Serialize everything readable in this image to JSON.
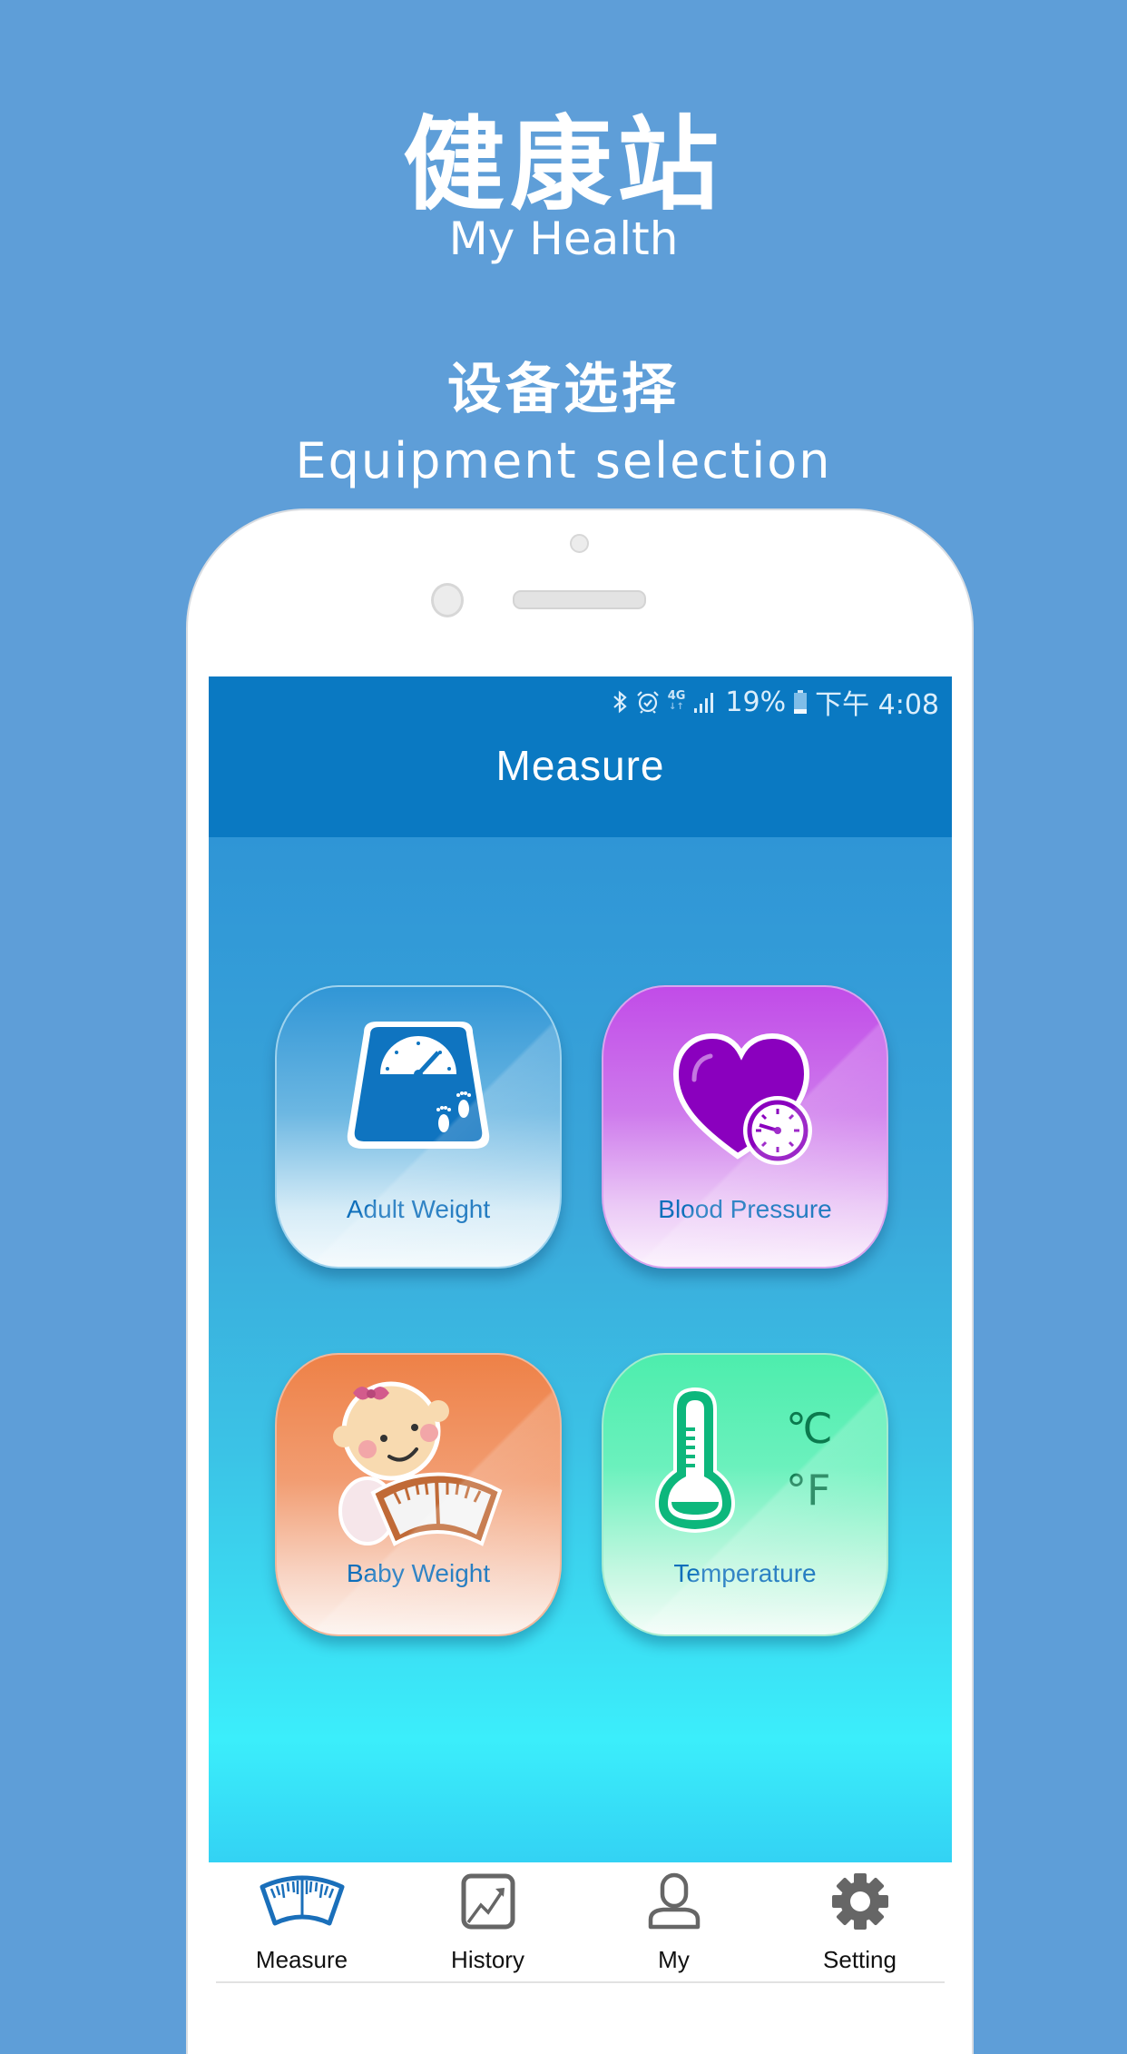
{
  "promo": {
    "title_cn": "健康站",
    "title_en": "My Health",
    "subtitle_cn": "设备选择",
    "subtitle_en": "Equipment selection"
  },
  "colors": {
    "background": "#5E9ED8",
    "header": "#0A79C2",
    "tile_label": "#0E6FBB",
    "nav_active_icon": "#1A6FBA",
    "nav_inactive_icon": "#666666"
  },
  "status_bar": {
    "icons": [
      "bluetooth-icon",
      "alarm-icon",
      "4g-icon",
      "signal-icon",
      "battery-icon"
    ],
    "network": "4G",
    "battery": "19%",
    "time": "下午 4:08"
  },
  "header": {
    "title": "Measure"
  },
  "tiles": [
    {
      "label": "Adult Weight",
      "icon": "bathroom-scale-icon"
    },
    {
      "label": "Blood Pressure",
      "icon": "heart-gauge-icon"
    },
    {
      "label": "Baby Weight",
      "icon": "baby-scale-icon"
    },
    {
      "label": "Temperature",
      "icon": "thermometer-icon",
      "units": [
        "℃",
        "°F"
      ]
    }
  ],
  "nav": {
    "active": "Measure",
    "items": [
      {
        "label": "Measure",
        "icon": "scale-dial-icon"
      },
      {
        "label": "History",
        "icon": "trend-chart-icon"
      },
      {
        "label": "My",
        "icon": "user-icon"
      },
      {
        "label": "Setting",
        "icon": "gear-icon"
      }
    ]
  }
}
